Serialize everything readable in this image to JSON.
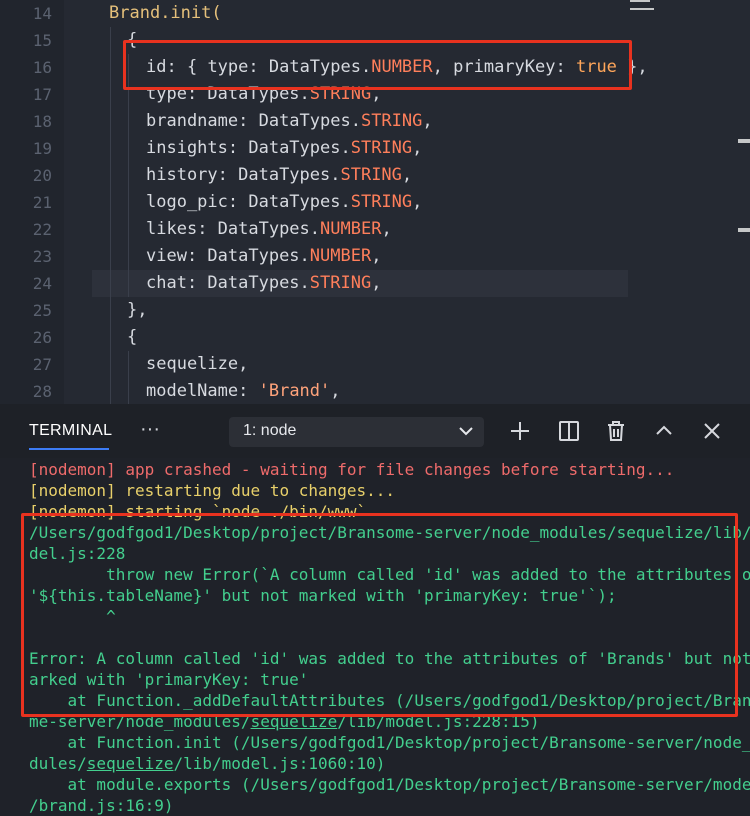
{
  "editor": {
    "line_numbers": [
      "14",
      "15",
      "16",
      "17",
      "18",
      "19",
      "20",
      "21",
      "22",
      "23",
      "24",
      "25",
      "26",
      "27",
      "28"
    ],
    "brand": "Brand",
    "init_call": ".init(",
    "open_brace": "{",
    "id_key": "id",
    "id_mid1": ": { ",
    "id_type_key": "type",
    "id_mid2": ": DataTypes.",
    "id_number": "NUMBER",
    "id_mid3": ", ",
    "id_pk_key": "primaryKey",
    "id_mid4": ": ",
    "id_true": "true",
    "id_end": " },",
    "fields": [
      {
        "key": "type",
        "sep": ": DataTypes.",
        "dtype": "STRING",
        "end": ","
      },
      {
        "key": "brandname",
        "sep": ": DataTypes.",
        "dtype": "STRING",
        "end": ","
      },
      {
        "key": "insights",
        "sep": ": DataTypes.",
        "dtype": "STRING",
        "end": ","
      },
      {
        "key": "history",
        "sep": ": DataTypes.",
        "dtype": "STRING",
        "end": ","
      },
      {
        "key": "logo_pic",
        "sep": ": DataTypes.",
        "dtype": "STRING",
        "end": ","
      },
      {
        "key": "likes",
        "sep": ": DataTypes.",
        "dtype": "NUMBER",
        "end": ","
      },
      {
        "key": "view",
        "sep": ": DataTypes.",
        "dtype": "NUMBER",
        "end": ","
      },
      {
        "key": "chat",
        "sep": ": DataTypes.",
        "dtype": "STRING",
        "end": ","
      }
    ],
    "close_brace": "},",
    "open_brace2": "{",
    "sequelize_line": "sequelize,",
    "model_name_key": "modelName",
    "model_name_sep": ": ",
    "model_name_val": "'Brand'",
    "model_name_end": ","
  },
  "terminal": {
    "tab_title": "TERMINAL",
    "more_label": "···",
    "selected_terminal": "1: node",
    "lines": {
      "crashed": "[nodemon] app crashed - waiting for file changes before starting...",
      "restarting": "[nodemon] restarting due to changes...",
      "starting": "[nodemon] starting `node ./bin/www`",
      "path1": "/Users/godfgod1/Desktop/project/Bransome-server/node_modules/sequelize/lib/mo",
      "path2": "del.js:228",
      "throw1": "        throw new Error(`A column called 'id' was added to the attributes of",
      "throw2": "'${this.tableName}' but not marked with 'primaryKey: true'`);",
      "caret": "        ^",
      "error1": "Error: A column called 'id' was added to the attributes of 'Brands' but not m",
      "error2": "arked with 'primaryKey: true'",
      "at1a": "    at Function._addDefaultAttributes (/Users/godfgod1/Desktop/project/Branso",
      "at1b_pre": "me-server/node_modules/",
      "at1b_link": "sequelize",
      "at1b_post": "/lib/model.js:228:15)",
      "at2a": "    at Function.init (/Users/godfgod1/Desktop/project/Bransome-server/node_mo",
      "at2b_pre": "dules/",
      "at2b_link": "sequelize",
      "at2b_post": "/lib/model.js:1060:10)",
      "at3a": "    at module.exports (/Users/godfgod1/Desktop/project/Bransome-server/models",
      "at3b": "/brand.js:16:9)"
    }
  },
  "colors": {
    "annotation_box": "#e8321f",
    "terminal_green": "#43cf8e",
    "terminal_red": "#ef6b6b",
    "terminal_yellow": "#e8d06a",
    "accent_tab": "#3d7cf5"
  },
  "icons": [
    "plus-icon",
    "split-terminal-icon",
    "trash-icon",
    "chevron-up-icon",
    "close-icon",
    "chevron-down-icon"
  ]
}
